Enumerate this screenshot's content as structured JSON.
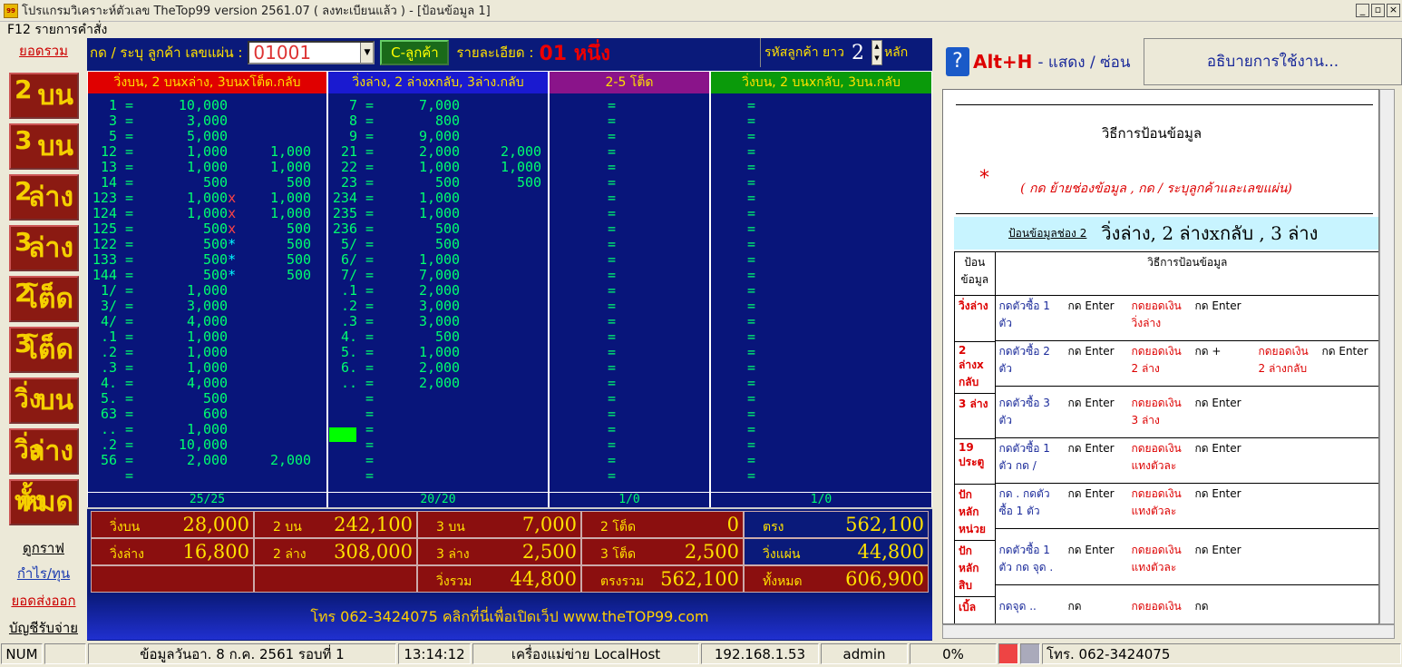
{
  "window": {
    "title": "โปรแกรมวิเคราะห์ตัวเลข TheTop99  version 2561.07  ( ลงทะเบียนแล้ว ) - [ป้อนข้อมูล 1]",
    "icon": "app-logo-icon"
  },
  "menu": {
    "label": "F12 รายการคำสั่ง"
  },
  "leftnav": {
    "total": "ยอดรวม",
    "graph": "ดูกราฟ",
    "profit": "กำไร/ทุน",
    "export": "ยอดส่งออก",
    "account": "บัญชีรับจ่าย",
    "buttons": [
      {
        "sup": "2",
        "main": "บน"
      },
      {
        "sup": "3",
        "main": "บน"
      },
      {
        "sup": "2",
        "main": "ล่าง"
      },
      {
        "sup": "3",
        "main": "ล่าง"
      },
      {
        "sup": "2",
        "main": "โต็ด"
      },
      {
        "sup": "3",
        "main": "โต็ด"
      },
      {
        "sup": "วิ่ง",
        "main": "บน"
      },
      {
        "sup": "วิ่ง",
        "main": "ล่าง"
      },
      {
        "sup": "ทั้ง",
        "main": "หมด"
      }
    ]
  },
  "toprow": {
    "prompt": "กด / ระบุ ลูกค้า เลขแผ่น :",
    "code": "01001",
    "cbtn": "C-ลูกค้า",
    "detail_label": "รายละเอียด :",
    "customer": "01 หนึ่ง",
    "len_label": "รหัสลูกค้า ยาว",
    "len_value": "2",
    "len_unit": "หลัก"
  },
  "columns": [
    {
      "header": "วิ่งบน, 2 บนxล่าง, 3บนxโต็ด.กลับ",
      "footer": "25/25",
      "rows": [
        [
          "1",
          "10,000",
          "",
          ""
        ],
        [
          "3",
          "3,000",
          "",
          ""
        ],
        [
          "5",
          "5,000",
          "",
          ""
        ],
        [
          "12",
          "1,000",
          "",
          "1,000"
        ],
        [
          "13",
          "1,000",
          "",
          "1,000"
        ],
        [
          "14",
          "500",
          "",
          "500"
        ],
        [
          "123",
          "1,000",
          "x",
          "1,000"
        ],
        [
          "124",
          "1,000",
          "x",
          "1,000"
        ],
        [
          "125",
          "500",
          "x",
          "500"
        ],
        [
          "122",
          "500",
          "*",
          "500"
        ],
        [
          "133",
          "500",
          "*",
          "500"
        ],
        [
          "144",
          "500",
          "*",
          "500"
        ],
        [
          "1/",
          "1,000",
          "",
          ""
        ],
        [
          "3/",
          "3,000",
          "",
          ""
        ],
        [
          "4/",
          "4,000",
          "",
          ""
        ],
        [
          ".1",
          "1,000",
          "",
          ""
        ],
        [
          ".2",
          "1,000",
          "",
          ""
        ],
        [
          ".3",
          "1,000",
          "",
          ""
        ],
        [
          "4.",
          "4,000",
          "",
          ""
        ],
        [
          "5.",
          "500",
          "",
          ""
        ],
        [
          "63",
          "600",
          "",
          ""
        ],
        [
          "..",
          "1,000",
          "",
          ""
        ],
        [
          ".2",
          "10,000",
          "",
          ""
        ],
        [
          "56",
          "2,000",
          "",
          "2,000"
        ],
        [
          "",
          "",
          "",
          ""
        ]
      ]
    },
    {
      "header": "วิ่งล่าง, 2 ล่างxกลับ, 3ล่าง.กลับ",
      "footer": "20/20",
      "rows": [
        [
          "7",
          "7,000",
          ""
        ],
        [
          "8",
          "800",
          ""
        ],
        [
          "9",
          "9,000",
          ""
        ],
        [
          "21",
          "2,000",
          "2,000"
        ],
        [
          "22",
          "1,000",
          "1,000"
        ],
        [
          "23",
          "500",
          "500"
        ],
        [
          "234",
          "1,000",
          ""
        ],
        [
          "235",
          "1,000",
          ""
        ],
        [
          "236",
          "500",
          ""
        ],
        [
          "5/",
          "500",
          ""
        ],
        [
          "6/",
          "1,000",
          ""
        ],
        [
          "7/",
          "7,000",
          ""
        ],
        [
          ".1",
          "2,000",
          ""
        ],
        [
          ".2",
          "3,000",
          ""
        ],
        [
          ".3",
          "3,000",
          ""
        ],
        [
          "4.",
          "500",
          ""
        ],
        [
          "5.",
          "1,000",
          ""
        ],
        [
          "6.",
          "2,000",
          ""
        ],
        [
          "..",
          "2,000",
          ""
        ]
      ]
    },
    {
      "header": "2-5 โต็ด",
      "footer": "1/0"
    },
    {
      "header": "วิ่งบน, 2 บนxกลับ, 3บน.กลับ",
      "footer": "1/0"
    }
  ],
  "totals": {
    "row1": [
      {
        "label": "วิ่งบน",
        "value": "28,000"
      },
      {
        "label": "2 บน",
        "value": "242,100"
      },
      {
        "label": "3 บน",
        "value": "7,000"
      },
      {
        "label": "2 โต็ด",
        "value": "0"
      },
      {
        "label": "ตรง",
        "value": "562,100"
      }
    ],
    "row2": [
      {
        "label": "วิ่งล่าง",
        "value": "16,800"
      },
      {
        "label": "2 ล่าง",
        "value": "308,000"
      },
      {
        "label": "3 ล่าง",
        "value": "2,500"
      },
      {
        "label": "3 โต็ด",
        "value": "2,500"
      },
      {
        "label": "วิ่งแผ่น",
        "value": "44,800"
      }
    ],
    "row3": [
      {
        "label": "วิ่งรวม",
        "value": "44,800"
      },
      {
        "label": "ตรงรวม",
        "value": "562,100"
      },
      {
        "label": "ทั้งหมด",
        "value": "606,900"
      }
    ]
  },
  "footer_text": "โทร  062-3424075  คลิกที่นี่เพื่อเปิดเว็ป  www.theTOP99.com",
  "help": {
    "hotkey": "Alt+H",
    "hotkey_desc": "- แสดง / ซ่อน",
    "explain": "อธิบายการใช้งาน...",
    "doc_title": "วิธีการป้อนข้อมูล",
    "instruction_star": "*",
    "instruction": "( กด  ย้ายช่องข้อมูล , กด / ระบุลูกค้าและเลขแผ่น)",
    "box_small": "ป้อนข้อมูลช่อง 2",
    "box_big": "วิ่งล่าง, 2 ล่างxกลับ ,  3 ล่าง",
    "th1": "ป้อน ข้อมูล",
    "th2": "วิธีการป้อนข้อมูล",
    "rows": [
      {
        "name": "วิ่งล่าง",
        "cells": [
          "กดตัวซื้อ 1 ตัว",
          "กด Enter",
          "กดยอดเงิน วิ่งล่าง",
          "กด Enter"
        ]
      },
      {
        "name": "2 ล่างx กลับ",
        "cells": [
          "กดตัวซื้อ 2 ตัว",
          "กด Enter",
          "กดยอดเงิน 2 ล่าง",
          "กด +",
          "กดยอดเงิน 2 ล่างกลับ",
          "กด Enter"
        ]
      },
      {
        "name": "3 ล่าง",
        "cells": [
          "กดตัวซื้อ 3 ตัว",
          "กด Enter",
          "กดยอดเงิน 3 ล่าง",
          "กด Enter"
        ]
      },
      {
        "name": "19 ประตู",
        "cells": [
          "กดตัวซื้อ 1 ตัว กด /",
          "กด Enter",
          "กดยอดเงิน แทงตัวละ",
          "กด Enter"
        ]
      },
      {
        "name": "ปักหลัก หน่วย",
        "cells": [
          "กด . กดตัว ซื้อ 1 ตัว",
          "กด Enter",
          "กดยอดเงิน แทงตัวละ",
          "กด Enter"
        ]
      },
      {
        "name": "ปักหลัก สิบ",
        "cells": [
          "กดตัวซื้อ 1 ตัว กด จุด .",
          "กด Enter",
          "กดยอดเงิน แทงตัวละ",
          "กด Enter"
        ]
      },
      {
        "name": "เบิ้ล",
        "cells": [
          "กดจุด ..",
          "กด",
          "กดยอดเงิน",
          "กด"
        ]
      }
    ]
  },
  "status": {
    "num": "NUM",
    "date": "ข้อมูลวันอา. 8 ก.ค. 2561 รอบที่ 1",
    "time": "13:14:12",
    "host": "เครื่องแม่ข่าย LocalHost",
    "ip": "192.168.1.53",
    "user": "admin",
    "pct": "0%",
    "phone": "โทร. 062-3424075"
  }
}
